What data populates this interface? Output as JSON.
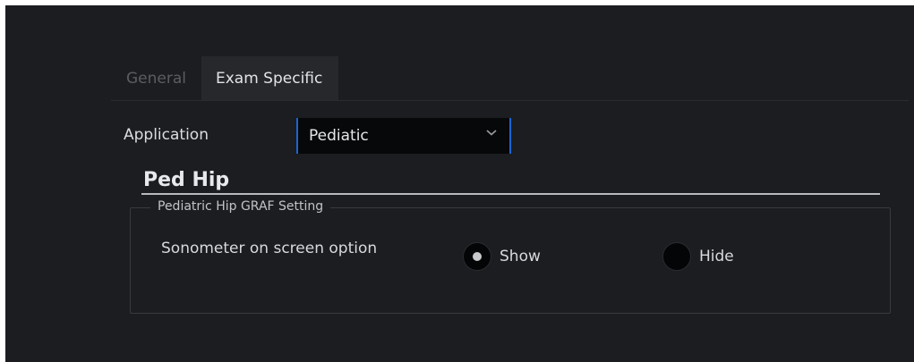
{
  "tabs": [
    {
      "label": "General",
      "active": false
    },
    {
      "label": "Exam Specific",
      "active": true
    }
  ],
  "application": {
    "label": "Application",
    "selected": "Pediatic"
  },
  "section": {
    "title": "Ped Hip"
  },
  "group": {
    "legend": "Pediatric Hip GRAF Setting",
    "option_label": "Sonometer on screen option",
    "radios": [
      {
        "label": "Show",
        "checked": true
      },
      {
        "label": "Hide",
        "checked": false
      }
    ]
  },
  "colors": {
    "background": "#1c1d20",
    "active_tab": "#27282c",
    "select_accent": "#1a64d6"
  }
}
